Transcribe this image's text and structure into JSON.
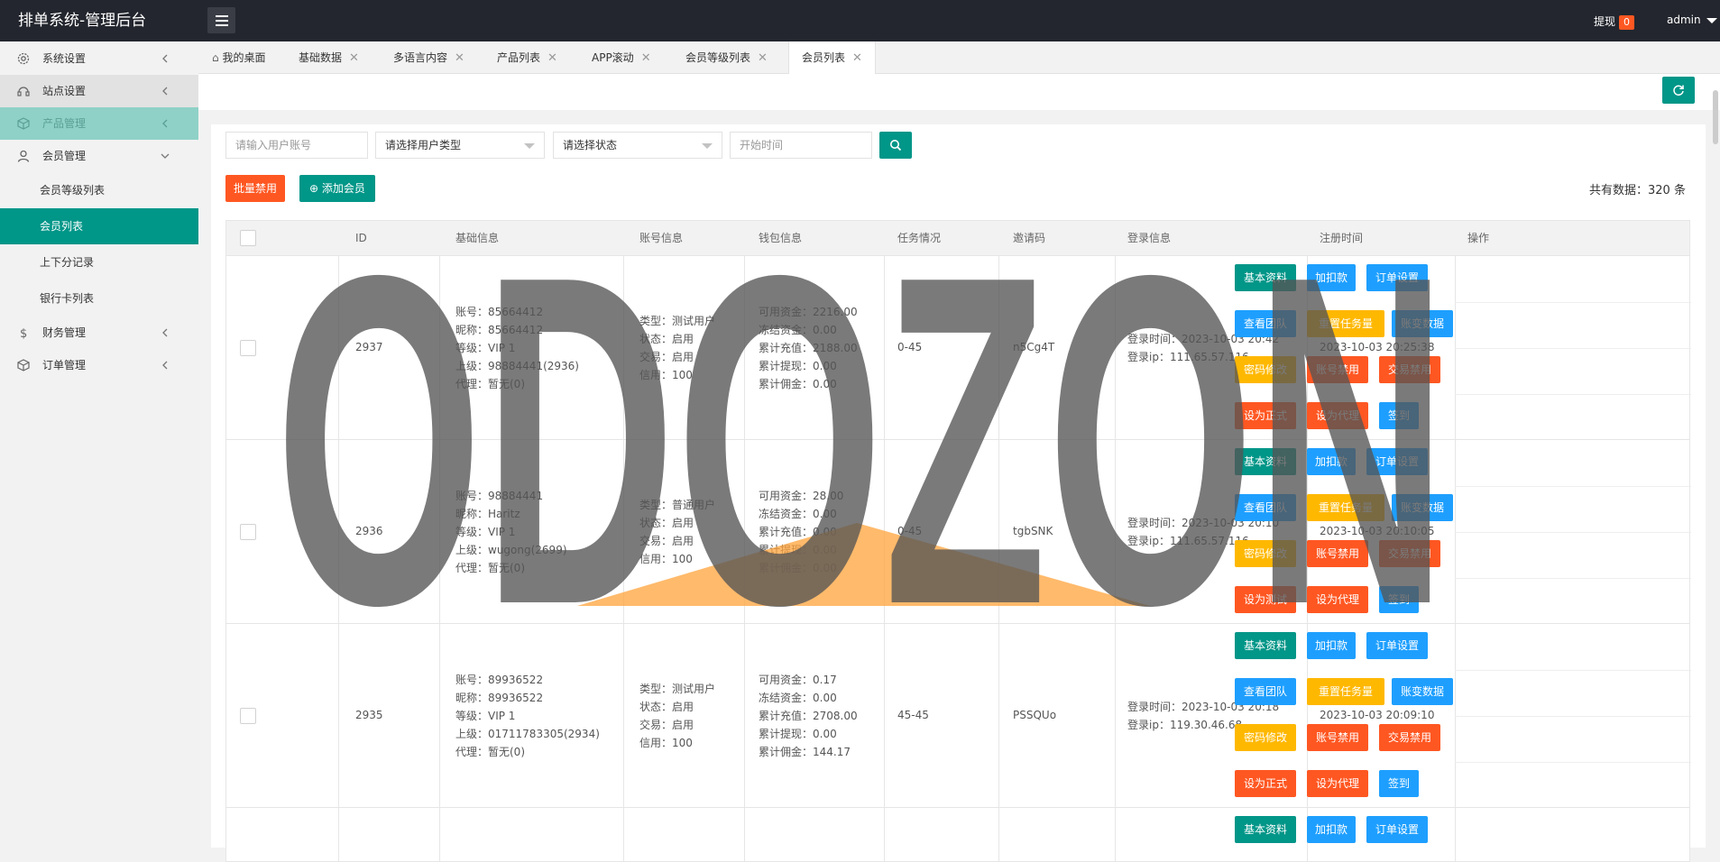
{
  "app": {
    "title": "排单系统-管理后台"
  },
  "header": {
    "withdraw_label": "提现",
    "withdraw_count": "0",
    "user": "admin"
  },
  "sidebar": {
    "items": [
      {
        "label": "系统设置",
        "icon": "gear-icon"
      },
      {
        "label": "站点设置",
        "icon": "support-icon"
      },
      {
        "label": "产品管理",
        "icon": "cube-icon"
      },
      {
        "label": "会员管理",
        "icon": "user-icon"
      },
      {
        "label": "财务管理",
        "icon": "dollar-icon"
      },
      {
        "label": "订单管理",
        "icon": "box-icon"
      }
    ],
    "member_sub": [
      "会员等级列表",
      "会员列表",
      "上下分记录",
      "银行卡列表"
    ]
  },
  "tabs": [
    {
      "label": "我的桌面"
    },
    {
      "label": "基础数据"
    },
    {
      "label": "多语言内容"
    },
    {
      "label": "产品列表"
    },
    {
      "label": "APP滚动"
    },
    {
      "label": "会员等级列表"
    },
    {
      "label": "会员列表"
    }
  ],
  "filters": {
    "account_placeholder": "请输入用户账号",
    "user_type": "请选择用户类型",
    "status": "请选择状态",
    "start_time_placeholder": "开始时间"
  },
  "toolbar": {
    "batch_disable": "批量禁用",
    "add_member": "添加会员",
    "total": "共有数据：320 条"
  },
  "table": {
    "headers": [
      "ID",
      "基础信息",
      "账号信息",
      "钱包信息",
      "任务情况",
      "邀请码",
      "登录信息",
      "注册时间",
      "操作"
    ],
    "actions": [
      "基本资料",
      "加扣款",
      "订单设置",
      "查看团队",
      "重置任务量",
      "账变数据",
      "密码修改",
      "账号禁用",
      "交易禁用"
    ],
    "rows": [
      {
        "id": "2937",
        "basic": [
          "账号：85664412",
          "昵称：85664412",
          "等级：VIP 1",
          "上级：98884441(2936)",
          "代理：暂无(0)"
        ],
        "account": [
          "类型：测试用户",
          "状态：启用",
          "交易：启用",
          "信用：100"
        ],
        "wallet": [
          "可用资金：2216.00",
          "冻结资金：0.00",
          "累计充值：2188.00",
          "累计提现：0.00",
          "累计佣金：0.00"
        ],
        "task": "0-45",
        "invite": "n5Cg4T",
        "login": [
          "登录时间：2023-10-03 20:42",
          "登录ip：111.65.57.116"
        ],
        "reg": "2023-10-03 20:25:38",
        "last_actions": [
          "设为正式",
          "设为代理",
          "签到"
        ]
      },
      {
        "id": "2936",
        "basic": [
          "账号：98884441",
          "昵称：Haritz",
          "等级：VIP 1",
          "上级：wugong(2699)",
          "代理：暂无(0)"
        ],
        "account": [
          "类型：普通用户",
          "状态：启用",
          "交易：启用",
          "信用：100"
        ],
        "wallet": [
          "可用资金：28.00",
          "冻结资金：0.00",
          "累计充值：0.00",
          "累计提现：0.00",
          "累计佣金：0.00"
        ],
        "task": "0-45",
        "invite": "tgbSNK",
        "login": [
          "登录时间：2023-10-03 20:10",
          "登录ip：111.65.57.116"
        ],
        "reg": "2023-10-03 20:10:05",
        "last_actions": [
          "设为测试",
          "设为代理",
          "签到"
        ]
      },
      {
        "id": "2935",
        "basic": [
          "账号：89936522",
          "昵称：89936522",
          "等级：VIP 1",
          "上级：01711783305(2934)",
          "代理：暂无(0)"
        ],
        "account": [
          "类型：测试用户",
          "状态：启用",
          "交易：启用",
          "信用：100"
        ],
        "wallet": [
          "可用资金：0.17",
          "冻结资金：0.00",
          "累计充值：2708.00",
          "累计提现：0.00",
          "累计佣金：144.17"
        ],
        "task": "45-45",
        "invite": "PSSQUo",
        "login": [
          "登录时间：2023-10-03 20:18",
          "登录ip：119.30.46.68"
        ],
        "reg": "2023-10-03 20:09:10",
        "last_actions": [
          "设为正式",
          "设为代理",
          "签到"
        ]
      }
    ]
  },
  "watermark": {
    "text": "ODOZON",
    "color": "#555555",
    "accent": "#ffa33a"
  },
  "colors": {
    "teal": "#009688",
    "blue": "#1e9fff",
    "yellow": "#ffb800",
    "red": "#ff5722"
  }
}
